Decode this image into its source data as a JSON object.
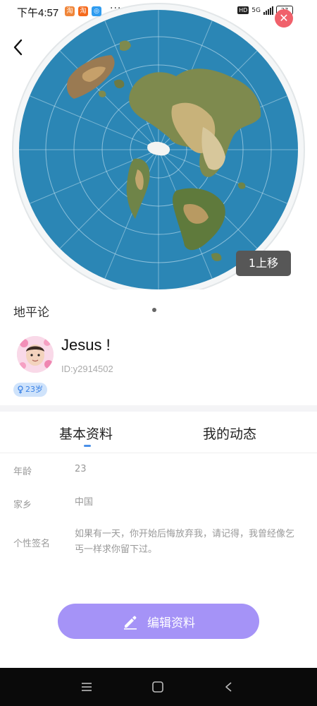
{
  "status_bar": {
    "time": "下午4:57",
    "apps": [
      {
        "icon": "taobao-orange-icon",
        "glyph": "淘",
        "color": "#f0863a"
      },
      {
        "icon": "taobao-icon",
        "glyph": "淘",
        "color": "#f56a1c"
      },
      {
        "icon": "app-blue-icon",
        "glyph": "◎",
        "color": "#2f9cf0"
      }
    ],
    "more": "···",
    "network_badge": "HD",
    "network": "5G",
    "battery": "27"
  },
  "hero": {
    "move_up_label": "1上移",
    "map_title": "地平论"
  },
  "profile": {
    "name": "Jesus !",
    "id_text": "ID:y2914502",
    "age_badge": "23岁",
    "age_icon": "female-symbol-icon"
  },
  "tabs": [
    {
      "label": "基本资料",
      "active": true
    },
    {
      "label": "我的动态",
      "active": false
    }
  ],
  "info": [
    {
      "label": "年龄",
      "value": "23"
    },
    {
      "label": "家乡",
      "value": "中国"
    },
    {
      "label": "个性签名",
      "value": "如果有一天，你开始后悔放弃我，请记得，我曾经像乞丐一样求你留下过。"
    }
  ],
  "edit_button": {
    "label": "编辑资料",
    "icon": "pencil-icon"
  },
  "colors": {
    "accent": "#a593f7",
    "tab_indicator": "#4a90e8",
    "ocean": "#2b86b5",
    "close": "#f0616b"
  },
  "nav": [
    "menu-icon",
    "home-square-icon",
    "back-triangle-icon"
  ]
}
